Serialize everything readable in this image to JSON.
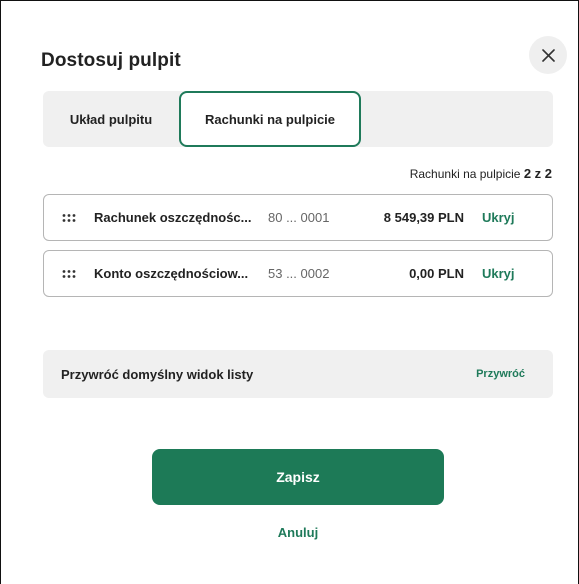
{
  "dialog": {
    "title": "Dostosuj pulpit",
    "close_icon": "close-icon"
  },
  "tabs": [
    {
      "label": "Układ pulpitu",
      "selected": false
    },
    {
      "label": "Rachunki na pulpicie",
      "selected": true
    }
  ],
  "counter": {
    "label": "Rachunki na pulpicie",
    "value": "2 z 2"
  },
  "accounts": [
    {
      "drag_icon": "drag-handle-icon",
      "name": "Rachunek oszczędnośc...",
      "number": "80 ... 0001",
      "balance": "8 549,39 PLN",
      "action": "Ukryj"
    },
    {
      "drag_icon": "drag-handle-icon",
      "name": "Konto oszczędnościow...",
      "number": "53 ... 0002",
      "balance": "0,00 PLN",
      "action": "Ukryj"
    }
  ],
  "restore": {
    "label": "Przywróć domyślny widok listy",
    "button": "Przywróć"
  },
  "footer": {
    "save": "Zapisz",
    "cancel": "Anuluj"
  },
  "colors": {
    "accent": "#1d7a57",
    "panel_bg": "#f0f0f0"
  }
}
